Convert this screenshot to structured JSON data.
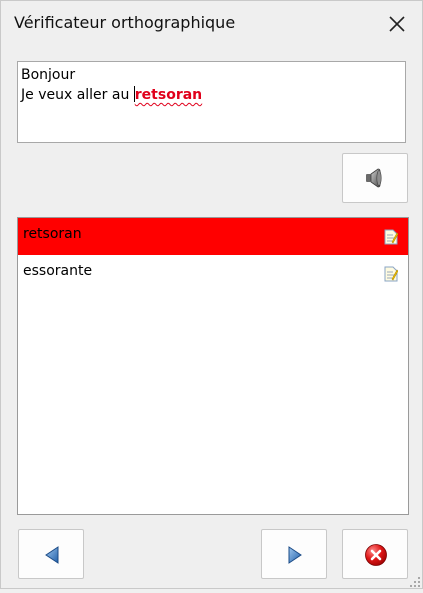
{
  "window": {
    "title": "Vérificateur orthographique"
  },
  "editor": {
    "line1": "Bonjour",
    "line2_prefix": "Je veux aller au ",
    "misspelled_word": "retsoran"
  },
  "suggestions": [
    {
      "label": "retsoran",
      "selected": true,
      "icon": "document-edit-icon"
    },
    {
      "label": "essorante",
      "selected": false,
      "icon": "document-edit-icon"
    }
  ],
  "buttons": {
    "speak": {
      "icon": "speaker-icon"
    },
    "previous": {
      "icon": "triangle-left-icon"
    },
    "next": {
      "icon": "triangle-right-icon"
    },
    "cancel": {
      "icon": "red-x-circle-icon"
    }
  },
  "colors": {
    "selected_row": "#ff0000",
    "misspelled_text": "#e0001b"
  }
}
